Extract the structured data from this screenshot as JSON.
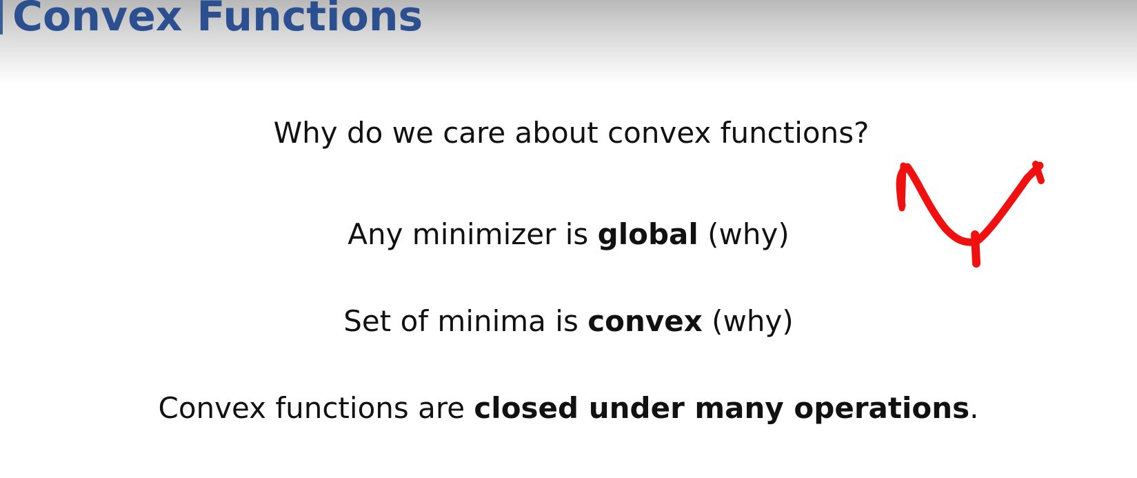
{
  "slide": {
    "title": "Convex Functions",
    "question": "Why do we care about convex functions?",
    "points": [
      {
        "pre": "Any minimizer is ",
        "bold": "global",
        "post": " (why)"
      },
      {
        "pre": "Set of minima is ",
        "bold": "convex",
        "post": " (why)"
      },
      {
        "pre": "Convex functions are ",
        "bold": "closed under many operations",
        "post": "."
      }
    ]
  },
  "colors": {
    "title": "#2b4f8f",
    "text": "#111111",
    "annotation_ink": "#f01010"
  },
  "annotation": {
    "icon": "hand-drawn-convex-curve"
  }
}
